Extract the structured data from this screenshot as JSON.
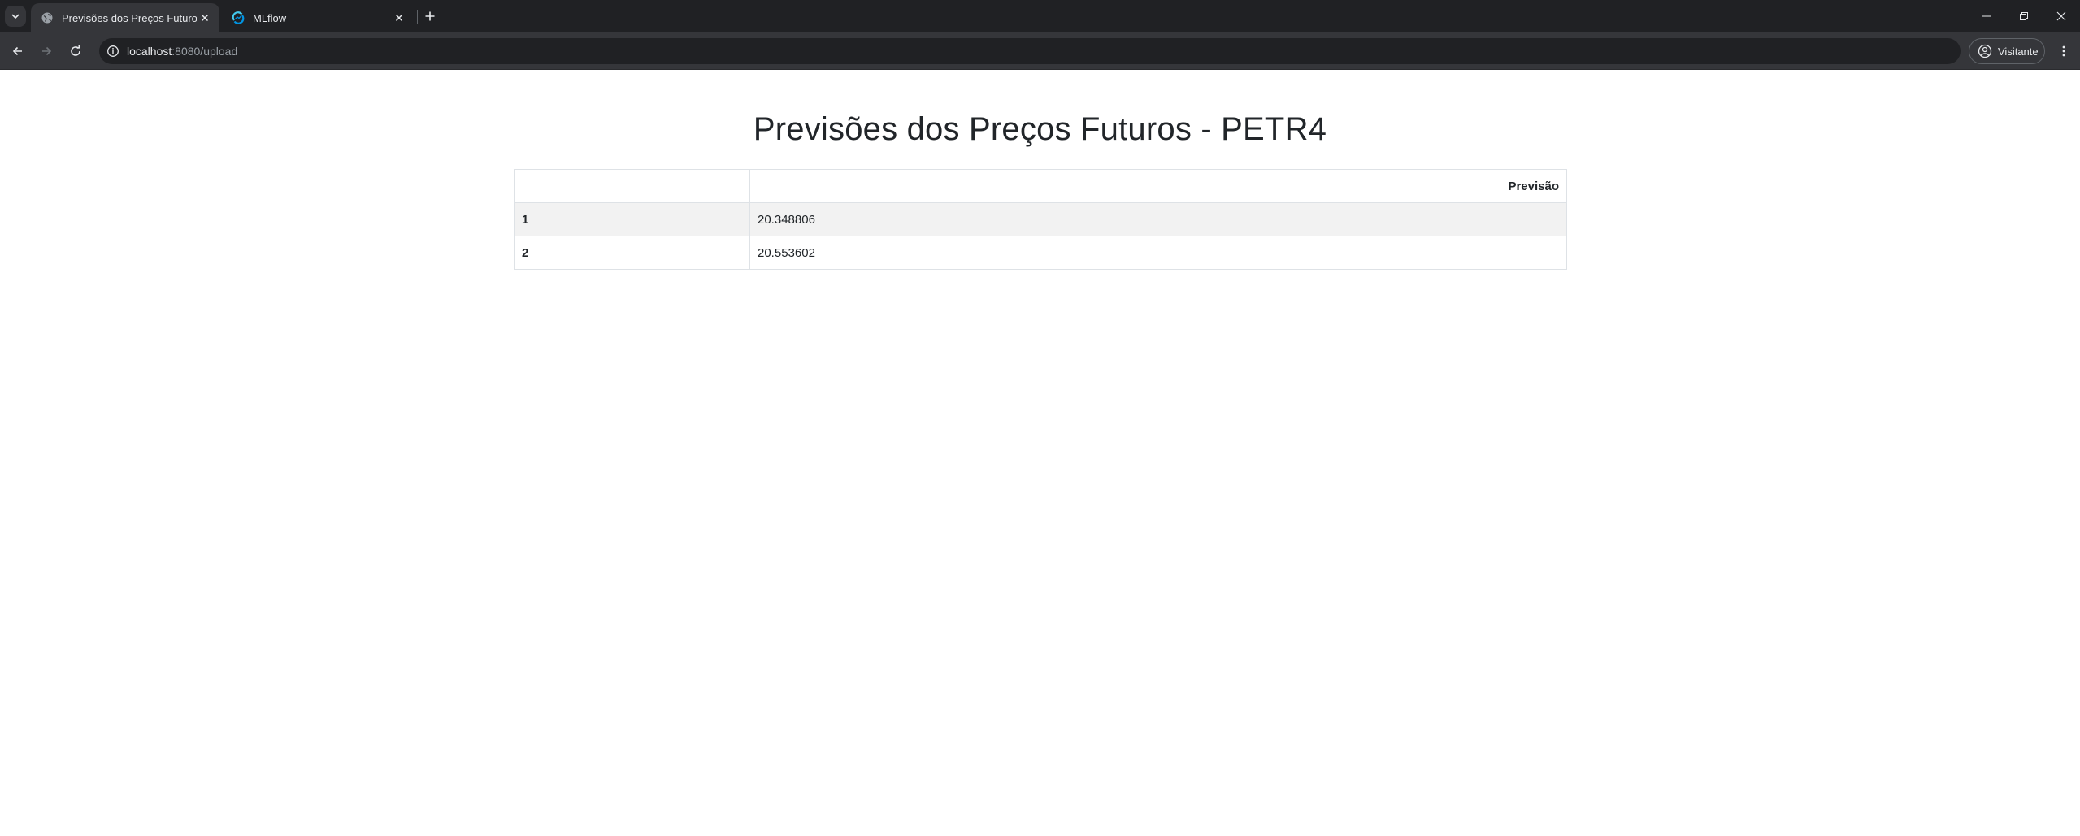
{
  "browser": {
    "tabs": [
      {
        "title": "Previsões dos Preços Futuros - PETR4",
        "active": true,
        "favicon": "globe-icon"
      },
      {
        "title": "MLflow",
        "active": false,
        "favicon": "mlflow-logo-icon"
      }
    ],
    "url": {
      "host": "localhost",
      "path": ":8080/upload"
    },
    "profile_label": "Visitante"
  },
  "page": {
    "title": "Previsões dos Preços Futuros - PETR4",
    "table": {
      "columns": [
        "",
        "Previsão"
      ],
      "rows": [
        {
          "index": "1",
          "value": "20.348806"
        },
        {
          "index": "2",
          "value": "20.553602"
        }
      ]
    }
  },
  "colors": {
    "tabstrip": "#202124",
    "toolbar": "#35363a",
    "text": "#212529",
    "table_border": "#dee2e6",
    "striped_row": "#f2f2f2"
  }
}
